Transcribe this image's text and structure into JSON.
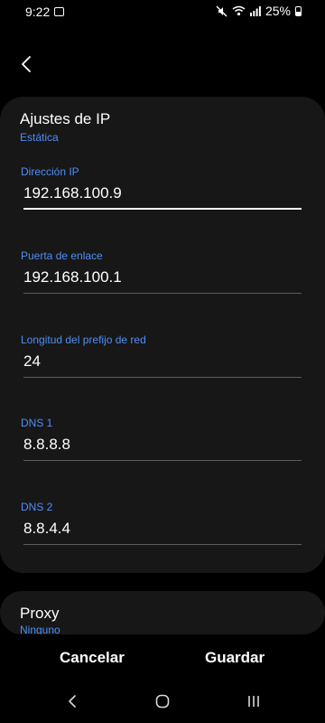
{
  "status_bar": {
    "time": "9:22",
    "battery_percent": "25%",
    "icons": [
      "gallery-icon",
      "mute-icon",
      "wifi-icon",
      "signal-icon",
      "battery-icon"
    ]
  },
  "header": {
    "back_icon": "chevron-left-icon"
  },
  "ip_settings": {
    "title": "Ajustes de IP",
    "mode": "Estática",
    "fields": [
      {
        "label": "Dirección IP",
        "value": "192.168.100.9"
      },
      {
        "label": "Puerta de enlace",
        "value": "192.168.100.1"
      },
      {
        "label": "Longitud del prefijo de red",
        "value": "24"
      },
      {
        "label": "DNS 1",
        "value": "8.8.8.8"
      },
      {
        "label": "DNS 2",
        "value": "8.8.4.4"
      }
    ]
  },
  "proxy": {
    "title": "Proxy",
    "value": "Ninguno"
  },
  "actions": {
    "cancel": "Cancelar",
    "save": "Guardar"
  },
  "nav": {
    "icons": [
      "back-icon",
      "home-icon",
      "recents-icon"
    ]
  },
  "colors": {
    "accent": "#4f8ef7",
    "card": "#171717",
    "background": "#000000"
  }
}
